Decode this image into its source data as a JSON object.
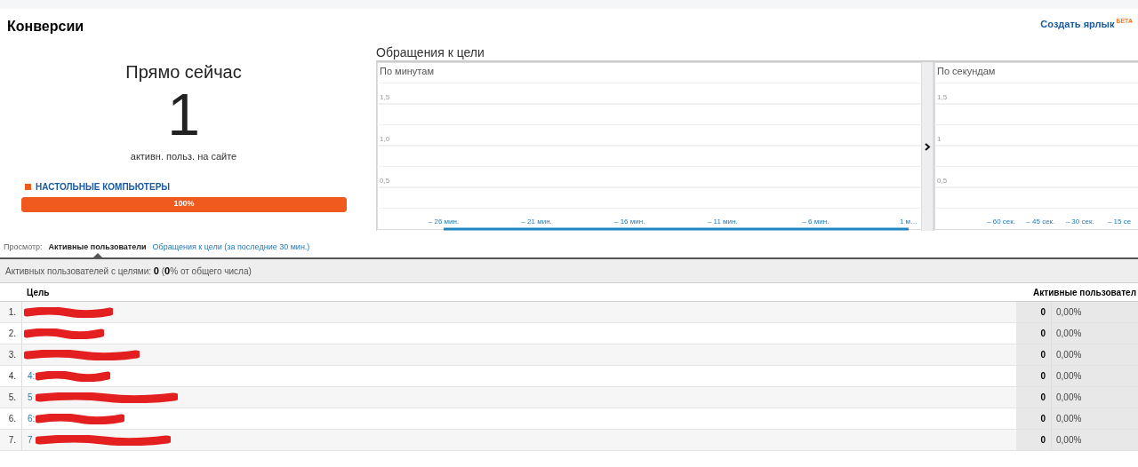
{
  "header": {
    "title": "Конверсии",
    "shortcut_link": "Создать ярлык",
    "shortcut_badge": "БЕТА"
  },
  "now": {
    "title": "Прямо сейчас",
    "count": "1",
    "caption": "активн. польз. на сайте",
    "devices": [
      {
        "label": "НАСТОЛЬНЫЕ КОМПЬЮТЕРЫ",
        "color": "#f05a1e",
        "level": 1,
        "reading": "100%"
      }
    ]
  },
  "goal_hits": {
    "title": "Обращения к цели",
    "charts": [
      {
        "caption": "По минутам",
        "chart_data": {
          "type": "line",
          "categories": [
            "– 26 мин.",
            "– 21 мин.",
            "– 16 мин.",
            "– 11 мин.",
            "– 6 мин.",
            "1 м…"
          ],
          "yticks": [
            {
              "value": 0.5,
              "label": "0,5"
            },
            {
              "value": 1.0,
              "label": "1,0"
            },
            {
              "value": 1.5,
              "label": "1,5"
            }
          ],
          "ylim": [
            0,
            2
          ],
          "grid": true,
          "series": [
            {
              "color": "#1f86c2",
              "values": [
                0,
                0,
                0,
                0,
                0,
                0
              ]
            }
          ]
        }
      },
      {
        "caption": "По секундам",
        "chart_data": {
          "type": "line",
          "categories": [
            "– 60 сек.",
            "– 45 сек.",
            "– 30 сек.",
            "– 15 се"
          ],
          "yticks": [
            {
              "value": 0.5,
              "label": "0,5"
            },
            {
              "value": 1,
              "label": "1"
            },
            {
              "value": 1.5,
              "label": "1,5"
            }
          ],
          "ylim": [
            0,
            2
          ],
          "grid": true
        }
      }
    ]
  },
  "view": {
    "label": "Просмотр:",
    "options": [
      {
        "label": "Активные пользователи",
        "selected": true
      },
      {
        "label": "Обращения к цели (за последние 30 мин.)",
        "selected": false
      }
    ]
  },
  "summary": "Активных пользователей с целями: **0** (**0**% от общего числа)",
  "table": {
    "columns": [
      "Цель",
      "Активные пользовател"
    ],
    "rows": [
      {
        "index": "1.",
        "users": "0",
        "share": "0,00%"
      },
      {
        "index": "2.",
        "users": "0",
        "share": "0,00%"
      },
      {
        "index": "3.",
        "users": "0",
        "share": "0,00%"
      },
      {
        "index": "4.",
        "goal": "4:",
        "users": "0",
        "share": "0,00%"
      },
      {
        "index": "5.",
        "goal": "5",
        "users": "0",
        "share": "0,00%"
      },
      {
        "index": "6.",
        "goal": "6:",
        "users": "0",
        "share": "0,00%"
      },
      {
        "index": "7.",
        "goal": "7",
        "users": "0",
        "share": "0,00%"
      }
    ]
  }
}
